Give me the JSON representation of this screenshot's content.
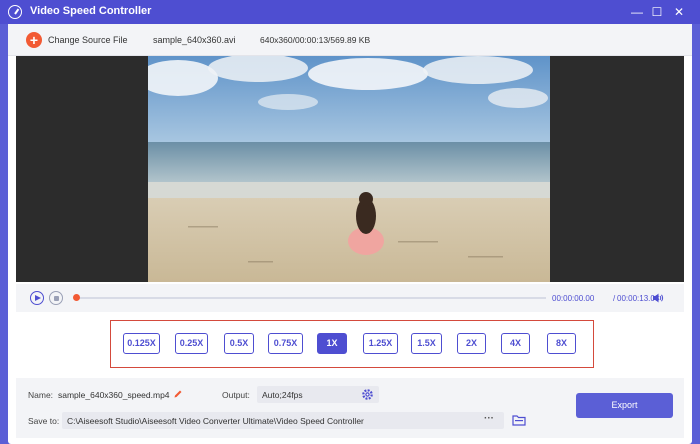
{
  "window": {
    "title": "Video Speed Controller",
    "minimize_glyph": "—",
    "maximize_glyph": "☐",
    "close_glyph": "✕"
  },
  "topbar": {
    "add_glyph": "+",
    "change_source_label": "Change Source File",
    "filename": "sample_640x360.avi",
    "fileinfo": "640x360/00:00:13/569.89 KB"
  },
  "player": {
    "time_current": "00:00:00.00",
    "time_separator": "/",
    "time_total": "00:00:13.08",
    "progress": 0.0
  },
  "speeds": [
    "0.125X",
    "0.25X",
    "0.5X",
    "0.75X",
    "1X",
    "1.25X",
    "1.5X",
    "2X",
    "4X",
    "8X"
  ],
  "selected_speed": "1X",
  "settings": {
    "name_label": "Name:",
    "name_value": "sample_640x360_speed.mp4",
    "output_label": "Output:",
    "output_value": "Auto;24fps",
    "save_label": "Save to:",
    "save_path": "C:\\Aiseesoft Studio\\Aiseesoft Video Converter Ultimate\\Video Speed Controller",
    "more_label": "···",
    "export_label": "Export"
  },
  "colors": {
    "accent": "#5b5fd6",
    "titlebar": "#4e4ed1",
    "highlight_border": "#d44a3c",
    "add_button": "#f25a34"
  },
  "icons": [
    "app-icon",
    "add-icon",
    "play-icon",
    "stop-icon",
    "volume-icon",
    "edit-icon",
    "gear-icon",
    "folder-icon"
  ]
}
